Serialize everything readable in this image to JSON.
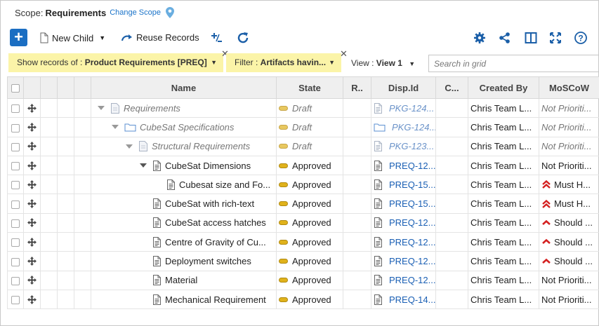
{
  "scope": {
    "label": "Scope:",
    "value": "Requirements",
    "change_link": "Change Scope"
  },
  "toolbar": {
    "new_child": "New Child",
    "reuse_records": "Reuse Records"
  },
  "filters": {
    "show_records": {
      "prefix": "Show records of : ",
      "value": "Product Requirements [PREQ]"
    },
    "filter": {
      "prefix": "Filter : ",
      "value": "Artifacts havin..."
    },
    "view_label": "View : ",
    "view_value": "View 1",
    "search_placeholder": "Search in grid"
  },
  "columns": [
    "Name",
    "State",
    "R..",
    "Disp.Id",
    "C...",
    "Created By",
    "MoSCoW"
  ],
  "rows": [
    {
      "name": "Requirements",
      "state": "Draft",
      "disp_id": "PKG-124...",
      "created_by": "Chris Team L...",
      "moscow": "Not Prioriti...",
      "draft": true,
      "icon": "package",
      "indent": 0,
      "expander": true
    },
    {
      "name": "CubeSat Specifications",
      "state": "Draft",
      "disp_id": "PKG-124...",
      "created_by": "Chris Team L...",
      "moscow": "Not Prioriti...",
      "draft": true,
      "icon": "folder",
      "indent": 1,
      "expander": true
    },
    {
      "name": "Structural Requirements",
      "state": "Draft",
      "disp_id": "PKG-123...",
      "created_by": "Chris Team L...",
      "moscow": "Not Prioriti...",
      "draft": true,
      "icon": "package",
      "indent": 2,
      "expander": true
    },
    {
      "name": "CubeSat Dimensions",
      "state": "Approved",
      "disp_id": "PREQ-12...",
      "created_by": "Chris Team L...",
      "moscow": "Not Prioriti...",
      "draft": false,
      "icon": "doc",
      "indent": 3,
      "expander": true
    },
    {
      "name": "Cubesat size and Fo...",
      "state": "Approved",
      "disp_id": "PREQ-15...",
      "created_by": "Chris Team L...",
      "moscow": "Must H...",
      "priority": "must",
      "draft": false,
      "icon": "doc",
      "indent": 4,
      "expander": false
    },
    {
      "name": "CubeSat with rich-text",
      "state": "Approved",
      "disp_id": "PREQ-15...",
      "created_by": "Chris Team L...",
      "moscow": "Must H...",
      "priority": "must",
      "draft": false,
      "icon": "doc",
      "indent": 3,
      "expander": false
    },
    {
      "name": "CubeSat access hatches",
      "state": "Approved",
      "disp_id": "PREQ-12...",
      "created_by": "Chris Team L...",
      "moscow": "Should ...",
      "priority": "should",
      "draft": false,
      "icon": "doc",
      "indent": 3,
      "expander": false
    },
    {
      "name": "Centre of Gravity of Cu...",
      "state": "Approved",
      "disp_id": "PREQ-12...",
      "created_by": "Chris Team L...",
      "moscow": "Should ...",
      "priority": "should",
      "draft": false,
      "icon": "doc",
      "indent": 3,
      "expander": false
    },
    {
      "name": "Deployment switches",
      "state": "Approved",
      "disp_id": "PREQ-12...",
      "created_by": "Chris Team L...",
      "moscow": "Should ...",
      "priority": "should",
      "draft": false,
      "icon": "doc",
      "indent": 3,
      "expander": false
    },
    {
      "name": "Material",
      "state": "Approved",
      "disp_id": "PREQ-12...",
      "created_by": "Chris Team L...",
      "moscow": "Not Prioriti...",
      "draft": false,
      "icon": "doc",
      "indent": 3,
      "expander": false
    },
    {
      "name": "Mechanical Requirement",
      "state": "Approved",
      "disp_id": "PREQ-14...",
      "created_by": "Chris Team L...",
      "moscow": "Not Prioriti...",
      "draft": false,
      "icon": "doc",
      "indent": 3,
      "expander": false
    }
  ],
  "colors": {
    "accent": "#1b6ec2",
    "chip": "#fbf4a8",
    "state": "#e0b21b",
    "priority": "#d42020"
  }
}
